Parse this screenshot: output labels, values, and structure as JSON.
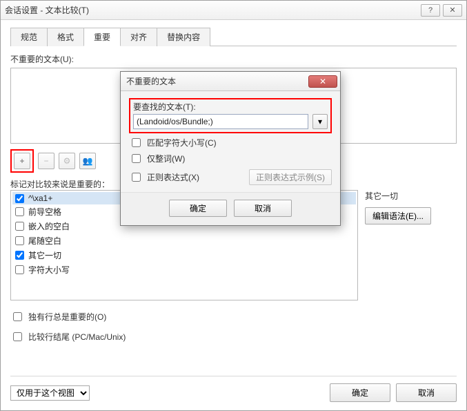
{
  "window": {
    "title": "会话设置 - 文本比较(T)",
    "help_icon": "?",
    "close_icon": "✕"
  },
  "tabs": [
    "规范",
    "格式",
    "重要",
    "对齐",
    "替换内容"
  ],
  "active_tab_index": 2,
  "unimportant": {
    "label": "不重要的文本(U):"
  },
  "toolbar": {
    "add": "+",
    "remove": "−",
    "gear": "⚙",
    "users": "👥"
  },
  "important": {
    "label": "标记对比较来说是重要的：",
    "items": [
      {
        "label": "^\\xa1+",
        "checked": true,
        "selected": true
      },
      {
        "label": "前导空格",
        "checked": false
      },
      {
        "label": "嵌入的空白",
        "checked": false
      },
      {
        "label": "尾随空白",
        "checked": false
      },
      {
        "label": "其它一切",
        "checked": true
      },
      {
        "label": "字符大小写",
        "checked": false
      }
    ],
    "side_label": "其它一切",
    "edit_grammar": "编辑语法(E)..."
  },
  "bottom_checks": {
    "exclusive_line": "独有行总是重要的(O)",
    "compare_eol": "比较行结尾 (PC/Mac/Unix)"
  },
  "footer": {
    "scope_options": [
      "仅用于这个视图"
    ],
    "scope_selected": "仅用于这个视图",
    "ok": "确定",
    "cancel": "取消"
  },
  "modal": {
    "title": "不重要的文本",
    "close": "✕",
    "find_label": "要查找的文本(T):",
    "find_value": "(Landoid/os/Bundle;)",
    "match_case": "匹配字符大小写(C)",
    "whole_word": "仅整词(W)",
    "regex": "正则表达式(X)",
    "regex_example": "正则表达式示例(S)",
    "ok": "确定",
    "cancel": "取消",
    "drop": "▾"
  }
}
